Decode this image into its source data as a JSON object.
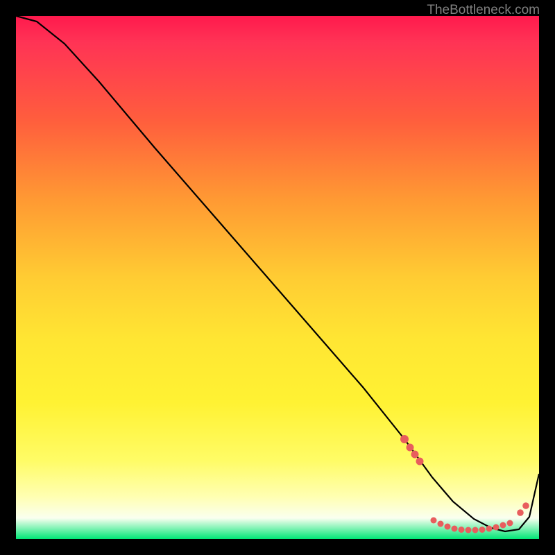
{
  "chart_data": {
    "type": "line",
    "watermark": "TheBottleneck.com",
    "title": "",
    "xlabel": "",
    "ylabel": "",
    "xlim": [
      0,
      100
    ],
    "ylim": [
      0,
      100
    ],
    "colors": {
      "line": "#000000",
      "dots": "#e85d5d",
      "gradient_top": "#ff1a4d",
      "gradient_bottom": "#00e676"
    },
    "curve": {
      "description": "Monotone descending curve reaching a flat minimum then rising slightly at the right edge.",
      "x": [
        0,
        5,
        15,
        25,
        35,
        45,
        55,
        65,
        72,
        78,
        82,
        86,
        90,
        94,
        100
      ],
      "y": [
        100,
        95,
        86,
        76,
        65,
        54,
        43,
        31,
        21,
        11,
        5,
        2,
        1,
        2,
        13
      ]
    },
    "dot_segment": {
      "description": "Salmon dotted overlay on the low portion of the curve.",
      "points": [
        {
          "x": 74,
          "y": 18
        },
        {
          "x": 75,
          "y": 15
        },
        {
          "x": 76.5,
          "y": 12
        },
        {
          "x": 80,
          "y": 3
        },
        {
          "x": 81,
          "y": 2.5
        },
        {
          "x": 82,
          "y": 2.2
        },
        {
          "x": 83,
          "y": 2
        },
        {
          "x": 84,
          "y": 1.8
        },
        {
          "x": 85,
          "y": 1.8
        },
        {
          "x": 86,
          "y": 1.8
        },
        {
          "x": 87,
          "y": 1.8
        },
        {
          "x": 88,
          "y": 2
        },
        {
          "x": 89,
          "y": 2.2
        },
        {
          "x": 90,
          "y": 2.5
        },
        {
          "x": 91,
          "y": 2.8
        },
        {
          "x": 92,
          "y": 3.2
        },
        {
          "x": 93,
          "y": 3.6
        },
        {
          "x": 95.5,
          "y": 7
        },
        {
          "x": 96.5,
          "y": 8.5
        }
      ],
      "radius_large": 5.5,
      "radius_small": 4.2
    }
  }
}
